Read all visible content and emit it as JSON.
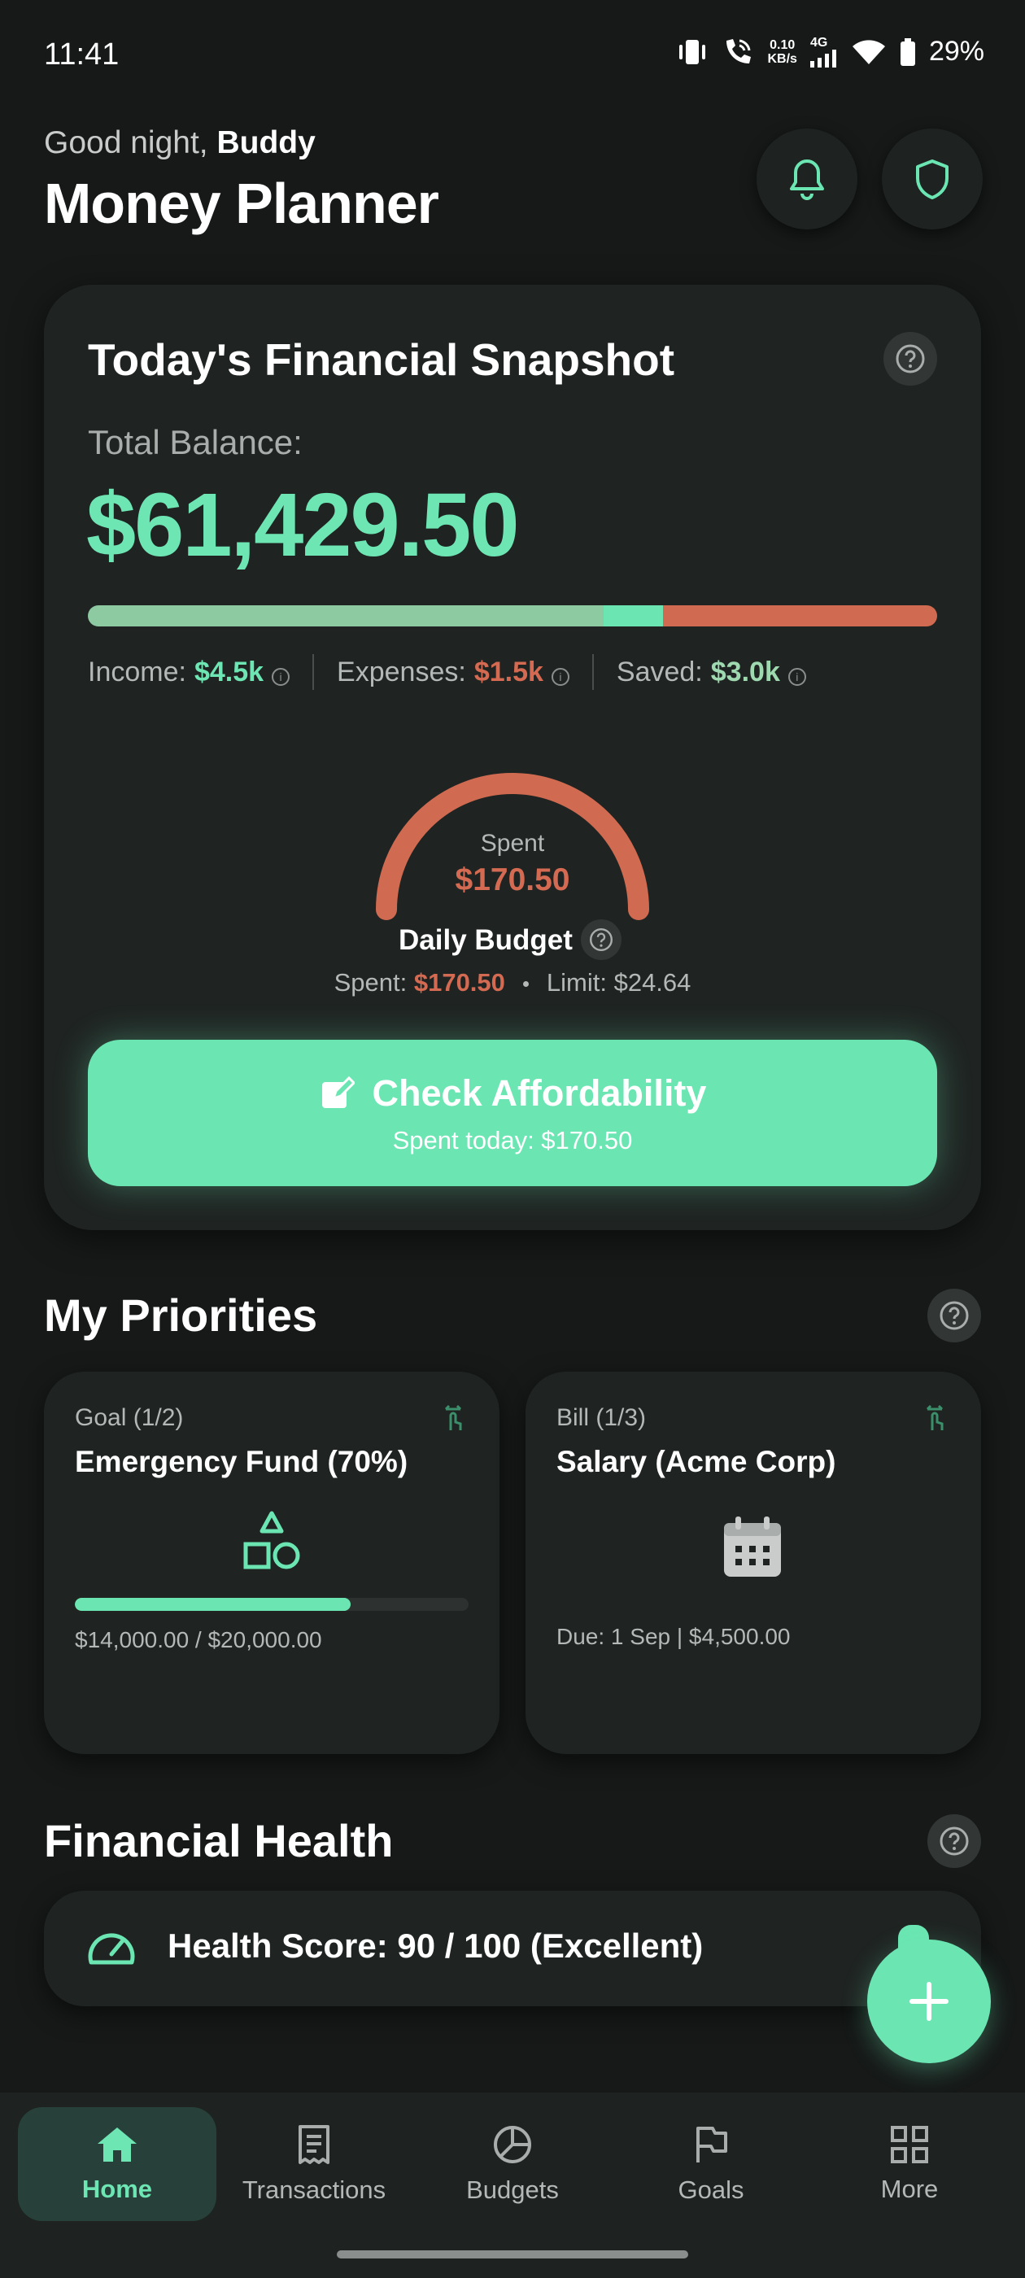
{
  "status_bar": {
    "time": "11:41",
    "net_speed_value": "0.10",
    "net_speed_unit": "KB/s",
    "network_type": "4G",
    "battery": "29%"
  },
  "header": {
    "greeting": "Good night,",
    "user_name": "Buddy",
    "app_title": "Money Planner"
  },
  "snapshot": {
    "title": "Today's Financial Snapshot",
    "balance_label": "Total Balance:",
    "balance_value": "$61,429.50",
    "balance_bar": {
      "income_fraction": 0.607,
      "saved_fraction": 0.07,
      "expenses_fraction": 0.323
    },
    "stats": [
      {
        "label": "Income:",
        "value": "$4.5k",
        "color": "#6ee6b4"
      },
      {
        "label": "Expenses:",
        "value": "$1.5k",
        "color": "#d46a51"
      },
      {
        "label": "Saved:",
        "value": "$3.0k",
        "color": "#9fd9b0"
      }
    ],
    "gauge_label": "Spent",
    "gauge_value": "$170.50",
    "daily_budget_label": "Daily Budget",
    "spent_label": "Spent:",
    "spent_value": "$170.50",
    "limit_text": "Limit: $24.64",
    "afford_button": "Check Affordability",
    "afford_sub": "Spent today: $170.50"
  },
  "priorities": {
    "title": "My Priorities",
    "cards": [
      {
        "kicker": "Goal (1/2)",
        "name": "Emergency Fund (70%)",
        "progress": 0.7,
        "footer": "$14,000.00 / $20,000.00"
      },
      {
        "kicker": "Bill (1/3)",
        "name": "Salary (Acme Corp)",
        "footer": "Due: 1 Sep | $4,500.00"
      }
    ]
  },
  "financial_health": {
    "title": "Financial Health",
    "score_text": "Health Score: 90 / 100 (Excellent)"
  },
  "nav": {
    "items": [
      {
        "label": "Home",
        "icon": "home-icon",
        "active": true
      },
      {
        "label": "Transactions",
        "icon": "receipt-icon"
      },
      {
        "label": "Budgets",
        "icon": "pie-chart-icon"
      },
      {
        "label": "Goals",
        "icon": "flag-icon"
      },
      {
        "label": "More",
        "icon": "grid-icon"
      }
    ]
  },
  "colors": {
    "accent": "#6be6b3",
    "expense": "#d46a51",
    "income_bar": "#8dc9a1",
    "saved_bar": "#6be6b3",
    "expenses_bar": "#d06a50",
    "background": "#161918",
    "card": "#1f2422"
  }
}
